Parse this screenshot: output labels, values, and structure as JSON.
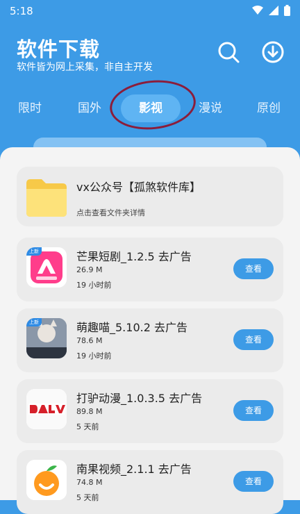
{
  "status_bar": {
    "time": "5:18",
    "icons": [
      "wifi-icon",
      "cellular-icon",
      "battery-icon"
    ]
  },
  "header": {
    "title": "软件下载",
    "subtitle": "软件皆为网上采集，非自主开发",
    "icons": [
      "search-icon",
      "download-icon"
    ]
  },
  "tabs": [
    {
      "label": "限时"
    },
    {
      "label": "国外"
    },
    {
      "label": "影视",
      "active": true
    },
    {
      "label": "漫说"
    },
    {
      "label": "原创"
    }
  ],
  "folder": {
    "title": "vx公众号【孤煞软件库】",
    "subtitle": "点击查看文件夹详情",
    "icon": "folder-icon"
  },
  "apps": [
    {
      "name": "芒果短剧_1.2.5 去广告",
      "size": "26.9 M",
      "time": "19 小时前",
      "button": "查看",
      "icon": "mango-shortplay-icon"
    },
    {
      "name": "萌趣喵_5.10.2 去广告",
      "size": "78.6 M",
      "time": "19 小时前",
      "button": "查看",
      "icon": "mengqumiao-icon"
    },
    {
      "name": "打驴动漫_1.0.3.5 去广告",
      "size": "89.8 M",
      "time": "5 天前",
      "button": "查看",
      "icon": "dalv-icon"
    },
    {
      "name": "南果视频_2.1.1 去广告",
      "size": "74.8 M",
      "time": "5 天前",
      "button": "查看",
      "icon": "nanguo-icon"
    }
  ],
  "colors": {
    "primary": "#3d9be6",
    "card": "#ebebeb",
    "sheet": "#f4f4f4"
  }
}
